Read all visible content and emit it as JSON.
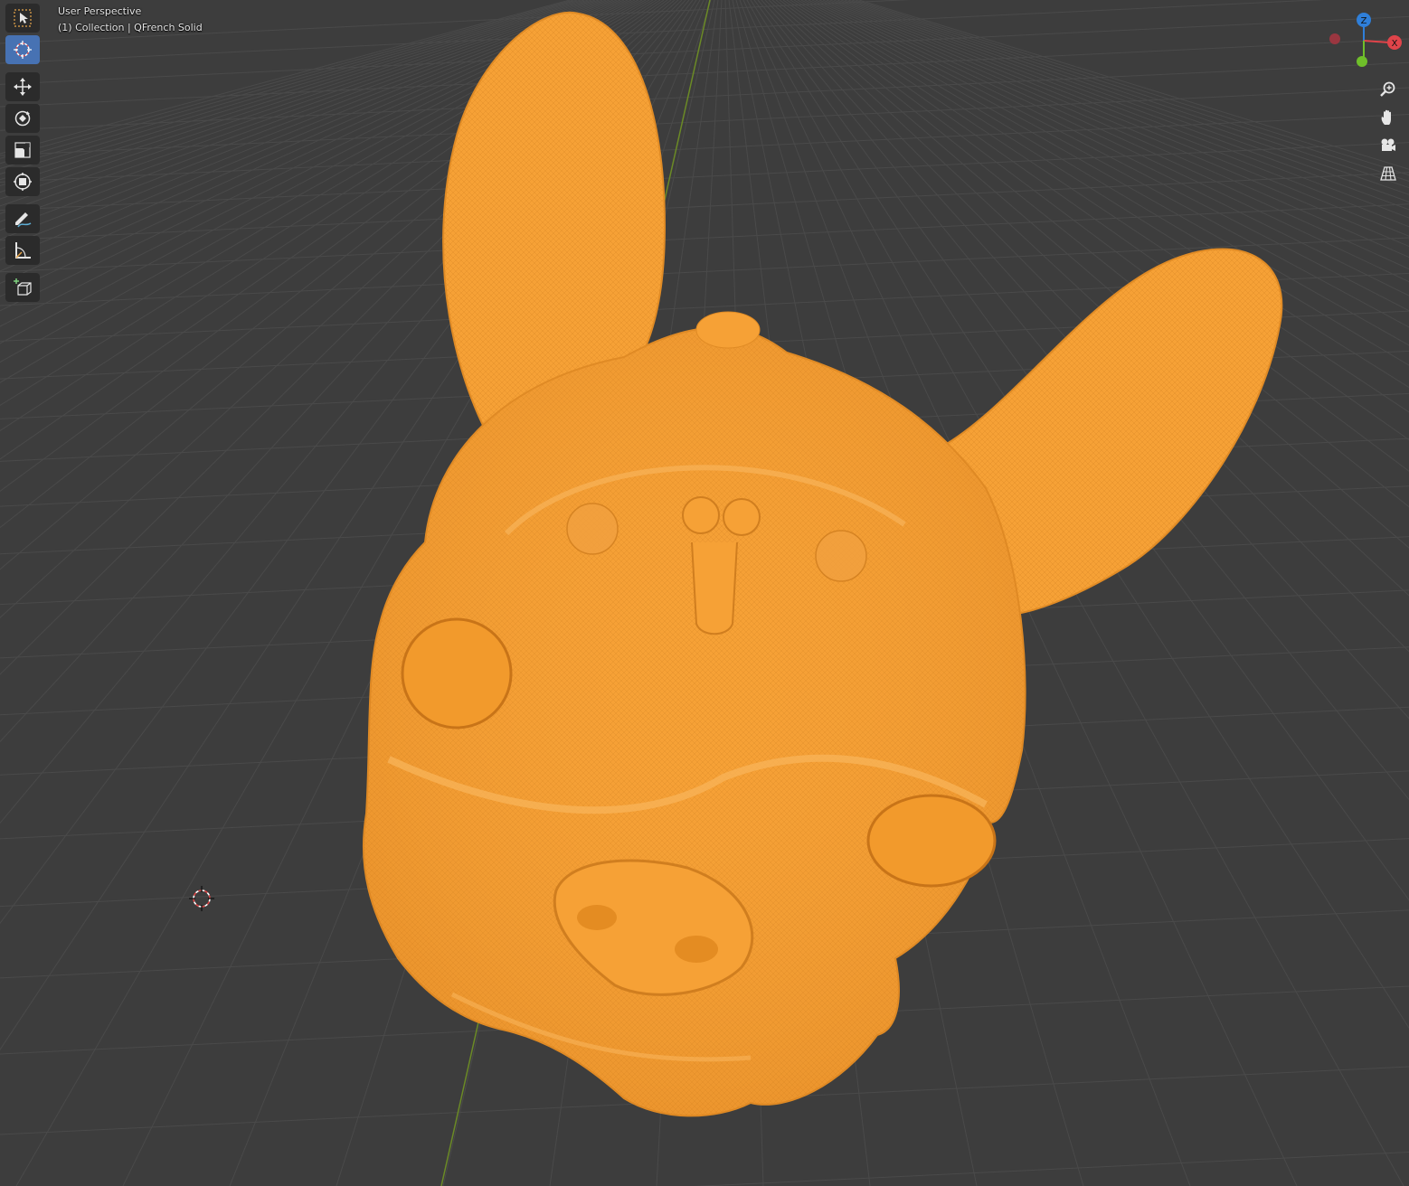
{
  "viewport": {
    "view_name": "User Perspective",
    "object_info": "(1) Collection | QFrench Solid",
    "background_color": "#3d3d3d",
    "grid_color": "#4b4b4b",
    "y_axis_color": "#7a9a2a",
    "mesh_color": "#f59b2d"
  },
  "toolbar": {
    "tools": [
      {
        "name": "select-box-tool",
        "icon": "select-box-icon",
        "active": false
      },
      {
        "name": "cursor-tool",
        "icon": "cursor-icon",
        "active": true
      },
      {
        "name": "move-tool",
        "icon": "move-icon",
        "active": false
      },
      {
        "name": "rotate-tool",
        "icon": "rotate-icon",
        "active": false
      },
      {
        "name": "scale-tool",
        "icon": "scale-icon",
        "active": false
      },
      {
        "name": "transform-tool",
        "icon": "transform-icon",
        "active": false
      },
      {
        "name": "annotate-tool",
        "icon": "annotate-icon",
        "active": false
      },
      {
        "name": "measure-tool",
        "icon": "measure-icon",
        "active": false
      },
      {
        "name": "add-cube-tool",
        "icon": "add-cube-icon",
        "active": false
      }
    ]
  },
  "gizmo": {
    "z_label": "Z",
    "x_label": "X",
    "z_color": "#2f7fd9",
    "x_color": "#e0444a",
    "y_color": "#6fbf2a",
    "neg_x_color": "#9a3640"
  },
  "navigation": {
    "buttons": [
      {
        "name": "zoom-button",
        "icon": "zoom-icon"
      },
      {
        "name": "pan-button",
        "icon": "hand-icon"
      },
      {
        "name": "camera-button",
        "icon": "camera-icon"
      },
      {
        "name": "perspective-button",
        "icon": "grid-perspective-icon"
      }
    ]
  }
}
